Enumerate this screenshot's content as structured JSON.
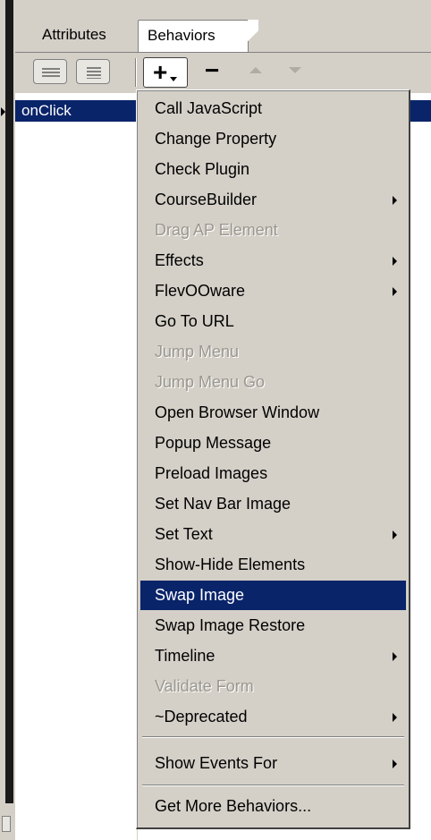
{
  "tabs": {
    "attributes": "Attributes",
    "behaviors": "Behaviors"
  },
  "toolbar": {
    "show_set_events_icon": "list-lines-icon",
    "show_all_events_icon": "list-lines-icon",
    "add_label": "+",
    "remove_label": "−",
    "move_up_icon": "triangle-up-icon",
    "move_down_icon": "triangle-down-icon"
  },
  "list": {
    "selected_event": "onClick"
  },
  "menu": {
    "items": [
      {
        "label": "Call JavaScript",
        "enabled": true,
        "submenu": false
      },
      {
        "label": "Change Property",
        "enabled": true,
        "submenu": false
      },
      {
        "label": "Check Plugin",
        "enabled": true,
        "submenu": false
      },
      {
        "label": "CourseBuilder",
        "enabled": true,
        "submenu": true
      },
      {
        "label": "Drag AP Element",
        "enabled": false,
        "submenu": false
      },
      {
        "label": "Effects",
        "enabled": true,
        "submenu": true
      },
      {
        "label": "FlevOOware",
        "enabled": true,
        "submenu": true
      },
      {
        "label": "Go To URL",
        "enabled": true,
        "submenu": false
      },
      {
        "label": "Jump Menu",
        "enabled": false,
        "submenu": false
      },
      {
        "label": "Jump Menu Go",
        "enabled": false,
        "submenu": false
      },
      {
        "label": "Open Browser Window",
        "enabled": true,
        "submenu": false
      },
      {
        "label": "Popup Message",
        "enabled": true,
        "submenu": false
      },
      {
        "label": "Preload Images",
        "enabled": true,
        "submenu": false
      },
      {
        "label": "Set Nav Bar Image",
        "enabled": true,
        "submenu": false
      },
      {
        "label": "Set Text",
        "enabled": true,
        "submenu": true
      },
      {
        "label": "Show-Hide Elements",
        "enabled": true,
        "submenu": false
      },
      {
        "label": "Swap Image",
        "enabled": true,
        "submenu": false,
        "selected": true
      },
      {
        "label": "Swap Image Restore",
        "enabled": true,
        "submenu": false
      },
      {
        "label": "Timeline",
        "enabled": true,
        "submenu": true
      },
      {
        "label": "Validate Form",
        "enabled": false,
        "submenu": false
      },
      {
        "label": "~Deprecated",
        "enabled": true,
        "submenu": true
      }
    ],
    "show_events_for": "Show Events For",
    "get_more": "Get More Behaviors..."
  },
  "colors": {
    "selection": "#0a246a",
    "menu_bg": "#d4d0c8",
    "disabled_text": "#9a978f"
  }
}
